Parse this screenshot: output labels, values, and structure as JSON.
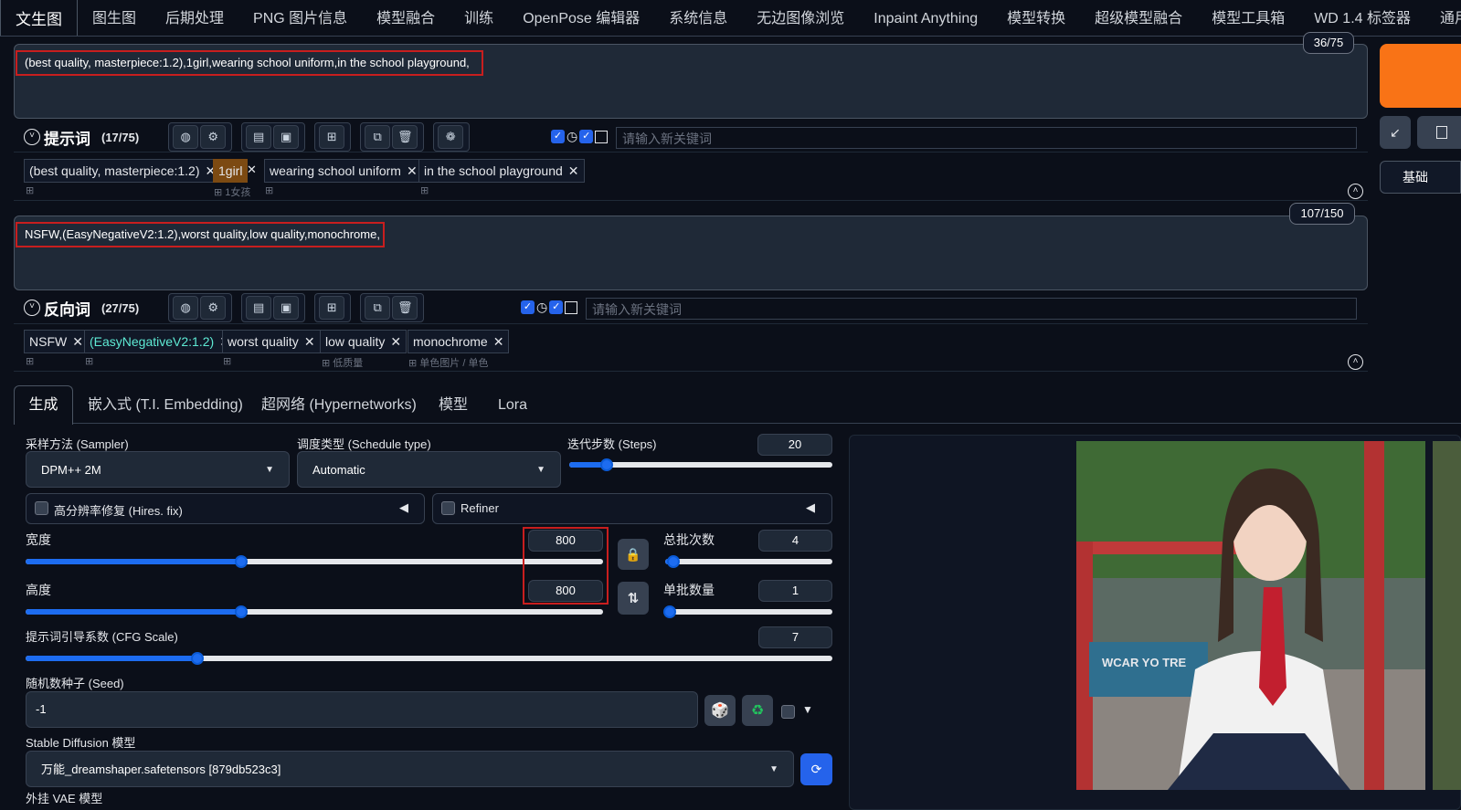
{
  "tabs": [
    "文生图",
    "图生图",
    "后期处理",
    "PNG 图片信息",
    "模型融合",
    "训练",
    "OpenPose 编辑器",
    "系统信息",
    "无边图像浏览",
    "Inpaint Anything",
    "模型转换",
    "超级模型融合",
    "模型工具箱",
    "WD 1.4 标签器",
    "通用"
  ],
  "prompt": {
    "text": "(best quality, masterpiece:1.2),1girl,wearing school uniform,in the school playground,",
    "counter": "36/75",
    "section_title": "提示词",
    "section_count": "(17/75)",
    "kw_placeholder": "请输入新关键词",
    "tags": [
      {
        "text": "(best quality, masterpiece:1.2)",
        "sub": ""
      },
      {
        "text": "1girl",
        "sub": "1女孩"
      },
      {
        "text": "wearing school uniform",
        "sub": ""
      },
      {
        "text": "in the school playground",
        "sub": ""
      }
    ]
  },
  "negative": {
    "text": "NSFW,(EasyNegativeV2:1.2),worst quality,low quality,monochrome,",
    "counter": "107/150",
    "section_title": "反向词",
    "section_count": "(27/75)",
    "kw_placeholder": "请输入新关键词",
    "tags": [
      {
        "text": "NSFW",
        "sub": ""
      },
      {
        "text": "(EasyNegativeV2:1.2)",
        "sub": ""
      },
      {
        "text": "worst quality",
        "sub": ""
      },
      {
        "text": "low quality",
        "sub": "低质量"
      },
      {
        "text": "monochrome",
        "sub": "单色图片 / 单色"
      }
    ]
  },
  "right_panel": {
    "basic_label": "基础"
  },
  "gen_tabs": [
    "生成",
    "嵌入式 (T.I. Embedding)",
    "超网络 (Hypernetworks)",
    "模型",
    "Lora"
  ],
  "params": {
    "sampler_label": "采样方法 (Sampler)",
    "sampler_value": "DPM++ 2M",
    "schedule_label": "调度类型 (Schedule type)",
    "schedule_value": "Automatic",
    "steps_label": "迭代步数 (Steps)",
    "steps_value": "20",
    "hires_label": "高分辨率修复 (Hires. fix)",
    "refiner_label": "Refiner",
    "width_label": "宽度",
    "width_value": "800",
    "height_label": "高度",
    "height_value": "800",
    "batch_count_label": "总批次数",
    "batch_count_value": "4",
    "batch_size_label": "单批数量",
    "batch_size_value": "1",
    "cfg_label": "提示词引导系数 (CFG Scale)",
    "cfg_value": "7",
    "seed_label": "随机数种子 (Seed)",
    "seed_value": "-1",
    "model_label": "Stable Diffusion 模型",
    "model_value": "万能_dreamshaper.safetensors [879db523c3]",
    "vae_label": "外挂 VAE 模型"
  },
  "image": {
    "sign_text": "WCAR YO TRE"
  },
  "colors": {
    "accent": "#f97316",
    "slider": "#1d6cf0",
    "highlight": "#c81e1e",
    "tag_hl": "#7c4a12"
  }
}
